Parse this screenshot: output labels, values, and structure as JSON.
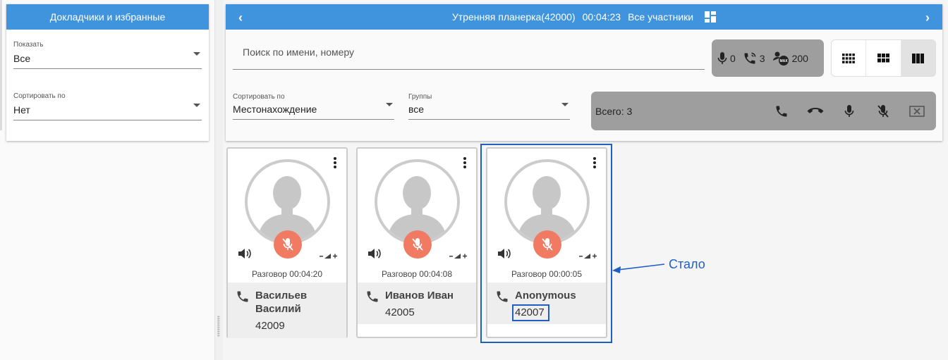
{
  "left_panel": {
    "title": "Докладчики и избранные",
    "show_label": "Показать",
    "show_value": "Все",
    "sort_label": "Сортировать по",
    "sort_value": "Нет"
  },
  "conference": {
    "title": "Утренняя планерка(42000)",
    "timer": "00:04:23",
    "participants_filter": "Все участники",
    "search_placeholder": "Поиск по имени, номеру",
    "stats": {
      "mic": "0",
      "calls": "3",
      "max": "200",
      "max_badge": "MAX"
    },
    "sort_label": "Сортировать по",
    "sort_value": "Местонахождение",
    "groups_label": "Группы",
    "groups_value": "все",
    "total": "Всего: 3"
  },
  "cards": [
    {
      "talk": "Разговор 00:04:20",
      "name": "Васильев Василий",
      "number": "42009"
    },
    {
      "talk": "Разговор 00:04:08",
      "name": "Иванов Иван",
      "number": "42005"
    },
    {
      "talk": "Разговор 00:00:05",
      "name": "Anonymous",
      "number": "42007"
    }
  ],
  "annotation": {
    "label": "Стало"
  },
  "colors": {
    "accent": "#3f94dd",
    "mute": "#f07a62",
    "annotation": "#1f5fc4"
  }
}
